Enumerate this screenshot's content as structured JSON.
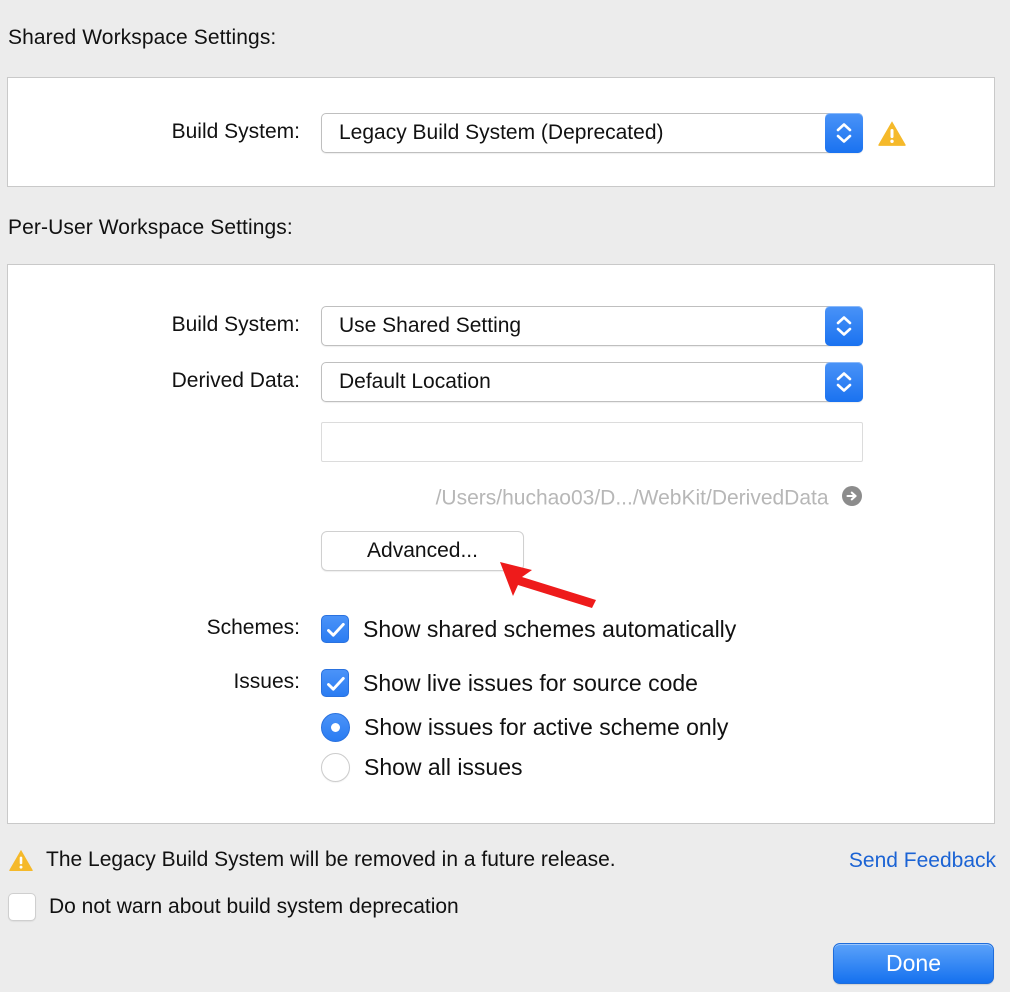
{
  "shared": {
    "heading": "Shared Workspace Settings:",
    "build_system": {
      "label": "Build System:",
      "value": "Legacy Build System (Deprecated)",
      "warning_icon": "warning-triangle-icon"
    }
  },
  "per_user": {
    "heading": "Per-User Workspace Settings:",
    "build_system": {
      "label": "Build System:",
      "value": "Use Shared Setting"
    },
    "derived_data": {
      "label": "Derived Data:",
      "value": "Default Location",
      "custom_path_value": "",
      "custom_path_placeholder": "",
      "resolved_path": "/Users/huchao03/D.../WebKit/DerivedData",
      "reveal_icon": "arrow-right-circle-icon",
      "advanced_button": "Advanced..."
    },
    "schemes": {
      "label": "Schemes:",
      "options": [
        {
          "text": "Show shared schemes automatically",
          "type": "checkbox",
          "checked": true
        }
      ]
    },
    "issues": {
      "label": "Issues:",
      "options": [
        {
          "text": "Show live issues for source code",
          "type": "checkbox",
          "checked": true
        },
        {
          "text": "Show issues for active scheme only",
          "type": "radio",
          "checked": true
        },
        {
          "text": "Show all issues",
          "type": "radio",
          "checked": false
        }
      ]
    }
  },
  "footer": {
    "warning_icon": "warning-triangle-icon",
    "warning_text": "The Legacy Build System will be removed in a future release.",
    "send_feedback": "Send Feedback",
    "do_not_warn": {
      "text": "Do not warn about build system deprecation",
      "checked": false
    },
    "done_button": "Done"
  },
  "annotation": {
    "arrow_color": "#ee1b1b",
    "points_at": "Advanced..."
  },
  "colors": {
    "window_background": "#ececec",
    "groupbox_background": "#ffffff",
    "groupbox_border": "#c9c9c9",
    "accent_blue": "#1a72f0",
    "link_blue": "#1b63d4",
    "warning_yellow": "#f5b92a",
    "path_gray": "#b7b7b7",
    "annotation_red": "#ee1b1b"
  }
}
